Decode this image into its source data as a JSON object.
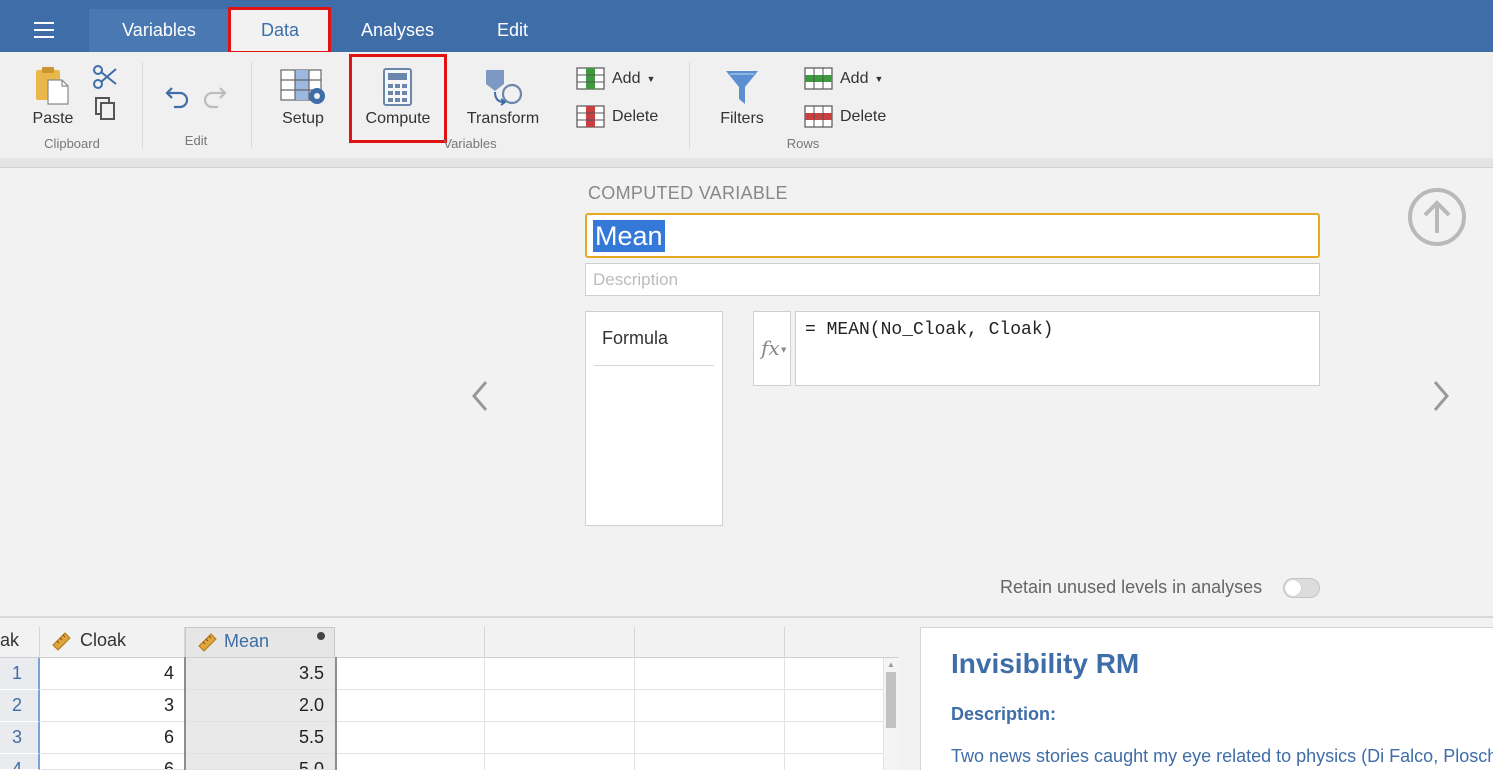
{
  "menu": {
    "tabs": [
      {
        "label": "Variables"
      },
      {
        "label": "Data"
      },
      {
        "label": "Analyses"
      },
      {
        "label": "Edit"
      }
    ],
    "active_tab": "Data"
  },
  "ribbon": {
    "clipboard": {
      "paste_label": "Paste",
      "group_label": "Clipboard"
    },
    "edit": {
      "group_label": "Edit"
    },
    "variables": {
      "setup_label": "Setup",
      "compute_label": "Compute",
      "transform_label": "Transform",
      "add_label": "Add",
      "delete_label": "Delete",
      "group_label": "Variables"
    },
    "rows": {
      "filters_label": "Filters",
      "add_label": "Add",
      "delete_label": "Delete",
      "group_label": "Rows"
    }
  },
  "computed_variable": {
    "heading": "COMPUTED VARIABLE",
    "name": "Mean",
    "description_placeholder": "Description",
    "formula_tab": "Formula",
    "fx_label": "fx",
    "formula": "= MEAN(No_Cloak, Cloak)",
    "retain_label": "Retain unused levels in analyses",
    "retain_unused_levels": false
  },
  "spreadsheet": {
    "partial_column": "ak",
    "columns": [
      {
        "name": "Cloak",
        "icon": "ruler-icon"
      },
      {
        "name": "Mean",
        "icon": "ruler-icon"
      }
    ],
    "rows": [
      {
        "num": "1",
        "cloak": "4",
        "mean": "3.5"
      },
      {
        "num": "2",
        "cloak": "3",
        "mean": "2.0"
      },
      {
        "num": "3",
        "cloak": "6",
        "mean": "5.5"
      },
      {
        "num": "4",
        "cloak": "6",
        "mean": "5.0"
      }
    ]
  },
  "results": {
    "title": "Invisibility RM",
    "description_label": "Description:",
    "body": "Two news stories caught my eye related to physics (Di Falco, Ploschner,"
  },
  "colors": {
    "menu_bar": "#3e6da8",
    "highlight_box": "#e01212",
    "focus_border": "#e6a825",
    "selection": "#3478d8"
  }
}
